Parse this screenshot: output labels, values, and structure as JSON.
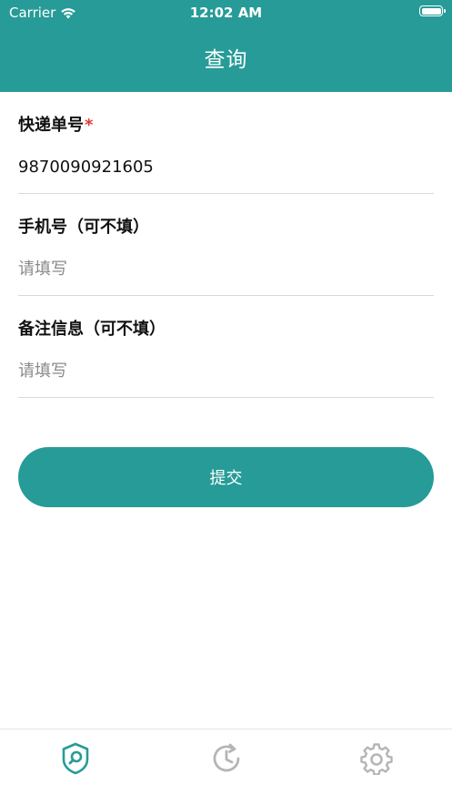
{
  "status_bar": {
    "carrier": "Carrier",
    "time": "12:02 AM",
    "icons": [
      "wifi-icon",
      "battery-icon"
    ]
  },
  "nav": {
    "title": "查询",
    "background": "#279b97"
  },
  "form": {
    "tracking": {
      "label": "快递单号",
      "required_mark": "*",
      "value": "9870090921605"
    },
    "phone": {
      "label": "手机号（可不填）",
      "placeholder": "请填写"
    },
    "remark": {
      "label": "备注信息（可不填）",
      "placeholder": "请填写"
    }
  },
  "submit": {
    "label": "提交",
    "color": "#279b97"
  },
  "tabbar": {
    "items": [
      {
        "icon": "shield-search-icon",
        "active": true,
        "color": "#279b97"
      },
      {
        "icon": "history-icon",
        "active": false,
        "color": "#b5b5b5"
      },
      {
        "icon": "gear-icon",
        "active": false,
        "color": "#b5b5b5"
      }
    ]
  }
}
